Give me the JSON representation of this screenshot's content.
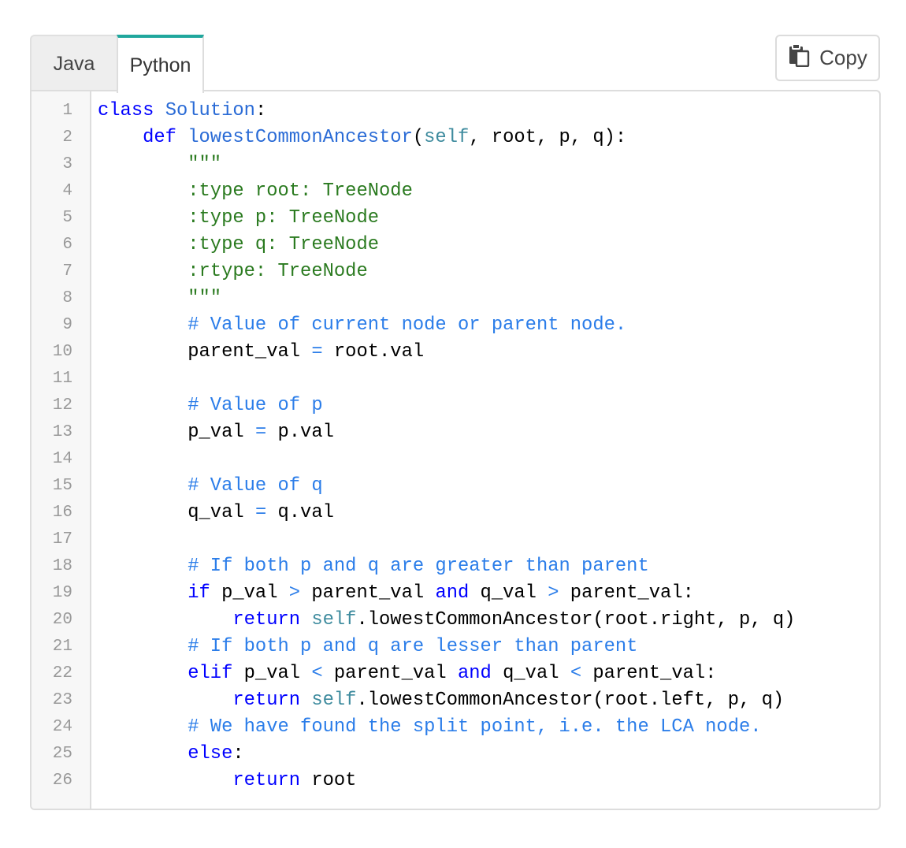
{
  "tabs": [
    {
      "label": "Java",
      "active": false
    },
    {
      "label": "Python",
      "active": true
    }
  ],
  "copy_button": {
    "label": "Copy",
    "icon": "clipboard-icon"
  },
  "code": {
    "language": "Python",
    "lines": [
      {
        "n": "1",
        "tokens": [
          [
            "kw",
            "class "
          ],
          [
            "cls",
            "Solution"
          ],
          [
            "",
            ":"
          ]
        ]
      },
      {
        "n": "2",
        "tokens": [
          [
            "",
            "    "
          ],
          [
            "kw",
            "def "
          ],
          [
            "fn",
            "lowestCommonAncestor"
          ],
          [
            "",
            "("
          ],
          [
            "self",
            "self"
          ],
          [
            "",
            ", root, p, q):"
          ]
        ]
      },
      {
        "n": "3",
        "tokens": [
          [
            "str",
            "        \"\"\""
          ]
        ]
      },
      {
        "n": "4",
        "tokens": [
          [
            "str",
            "        :type root: TreeNode"
          ]
        ]
      },
      {
        "n": "5",
        "tokens": [
          [
            "str",
            "        :type p: TreeNode"
          ]
        ]
      },
      {
        "n": "6",
        "tokens": [
          [
            "str",
            "        :type q: TreeNode"
          ]
        ]
      },
      {
        "n": "7",
        "tokens": [
          [
            "str",
            "        :rtype: TreeNode"
          ]
        ]
      },
      {
        "n": "8",
        "tokens": [
          [
            "str",
            "        \"\"\""
          ]
        ]
      },
      {
        "n": "9",
        "tokens": [
          [
            "com",
            "        # Value of current node or parent node."
          ]
        ]
      },
      {
        "n": "10",
        "tokens": [
          [
            "",
            "        parent_val "
          ],
          [
            "op",
            "="
          ],
          [
            "",
            " root.val"
          ]
        ]
      },
      {
        "n": "11",
        "tokens": []
      },
      {
        "n": "12",
        "tokens": [
          [
            "com",
            "        # Value of p"
          ]
        ]
      },
      {
        "n": "13",
        "tokens": [
          [
            "",
            "        p_val "
          ],
          [
            "op",
            "="
          ],
          [
            "",
            " p.val"
          ]
        ]
      },
      {
        "n": "14",
        "tokens": []
      },
      {
        "n": "15",
        "tokens": [
          [
            "com",
            "        # Value of q"
          ]
        ]
      },
      {
        "n": "16",
        "tokens": [
          [
            "",
            "        q_val "
          ],
          [
            "op",
            "="
          ],
          [
            "",
            " q.val"
          ]
        ]
      },
      {
        "n": "17",
        "tokens": []
      },
      {
        "n": "18",
        "tokens": [
          [
            "com",
            "        # If both p and q are greater than parent"
          ]
        ]
      },
      {
        "n": "19",
        "tokens": [
          [
            "",
            "        "
          ],
          [
            "kw",
            "if"
          ],
          [
            "",
            " p_val "
          ],
          [
            "op",
            ">"
          ],
          [
            "",
            " parent_val "
          ],
          [
            "kw",
            "and"
          ],
          [
            "",
            " q_val "
          ],
          [
            "op",
            ">"
          ],
          [
            "",
            " parent_val:"
          ]
        ]
      },
      {
        "n": "20",
        "tokens": [
          [
            "",
            "            "
          ],
          [
            "kw",
            "return "
          ],
          [
            "self",
            "self"
          ],
          [
            "",
            ".lowestCommonAncestor(root.right, p, q)"
          ]
        ]
      },
      {
        "n": "21",
        "tokens": [
          [
            "com",
            "        # If both p and q are lesser than parent"
          ]
        ]
      },
      {
        "n": "22",
        "tokens": [
          [
            "",
            "        "
          ],
          [
            "kw",
            "elif"
          ],
          [
            "",
            " p_val "
          ],
          [
            "op",
            "<"
          ],
          [
            "",
            " parent_val "
          ],
          [
            "kw",
            "and"
          ],
          [
            "",
            " q_val "
          ],
          [
            "op",
            "<"
          ],
          [
            "",
            " parent_val:"
          ]
        ]
      },
      {
        "n": "23",
        "tokens": [
          [
            "",
            "            "
          ],
          [
            "kw",
            "return "
          ],
          [
            "self",
            "self"
          ],
          [
            "",
            ".lowestCommonAncestor(root.left, p, q)"
          ]
        ]
      },
      {
        "n": "24",
        "tokens": [
          [
            "com",
            "        # We have found the split point, i.e. the LCA node."
          ]
        ]
      },
      {
        "n": "25",
        "tokens": [
          [
            "",
            "        "
          ],
          [
            "kw",
            "else"
          ],
          [
            "",
            ":"
          ]
        ]
      },
      {
        "n": "26",
        "tokens": [
          [
            "",
            "            "
          ],
          [
            "kw",
            "return"
          ],
          [
            "",
            " root"
          ]
        ]
      }
    ]
  }
}
